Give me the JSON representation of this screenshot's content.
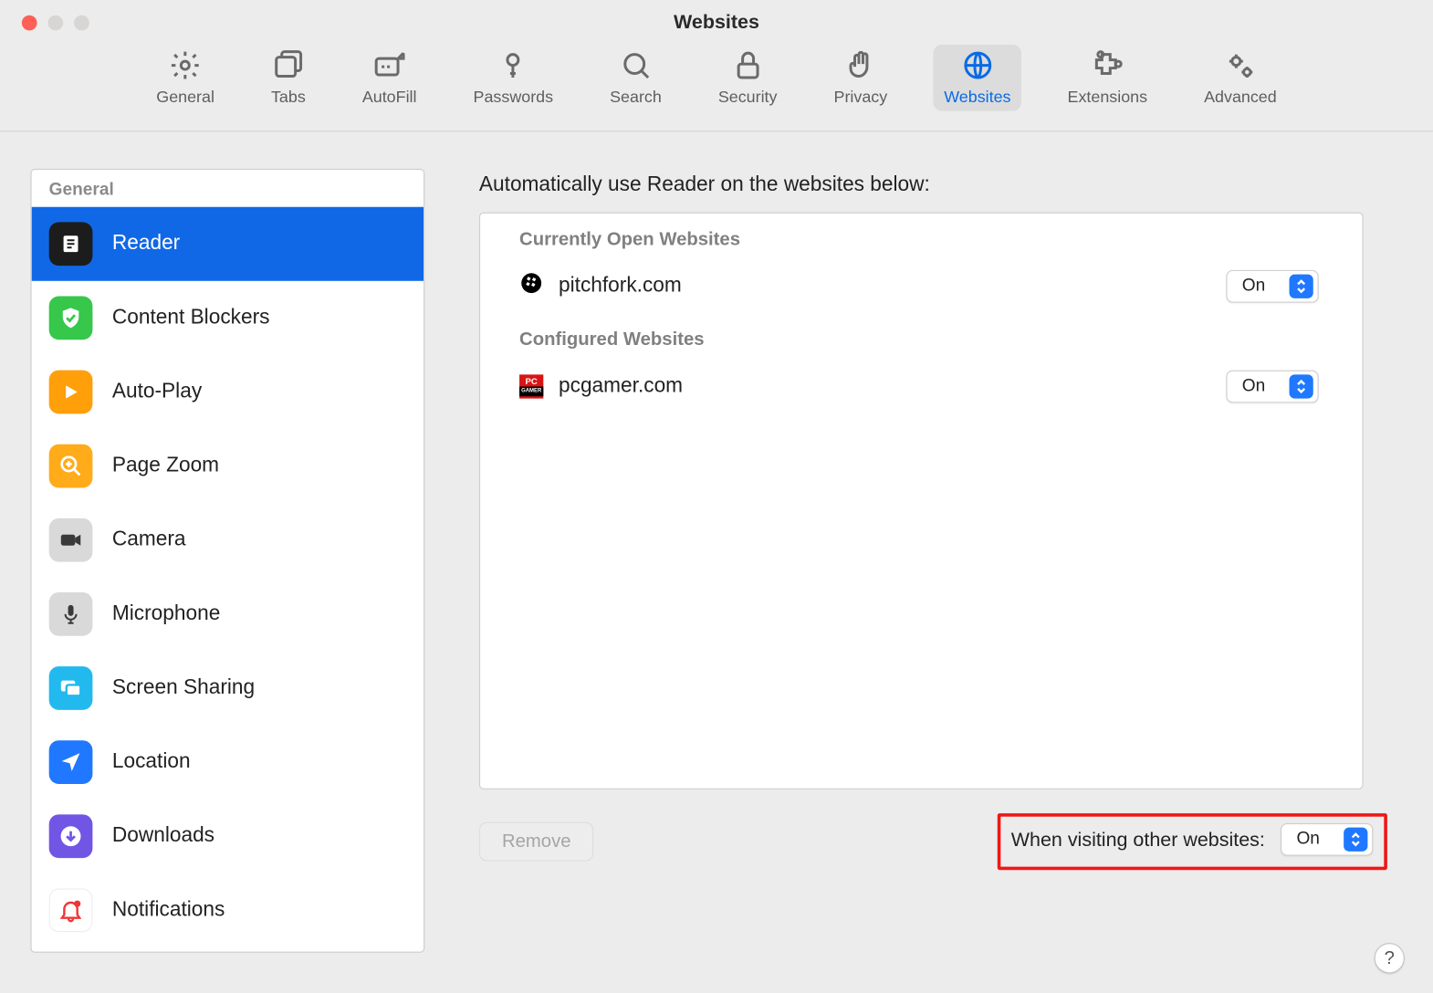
{
  "window": {
    "title": "Websites"
  },
  "toolbar": {
    "items": [
      {
        "label": "General"
      },
      {
        "label": "Tabs"
      },
      {
        "label": "AutoFill"
      },
      {
        "label": "Passwords"
      },
      {
        "label": "Search"
      },
      {
        "label": "Security"
      },
      {
        "label": "Privacy"
      },
      {
        "label": "Websites",
        "selected": true
      },
      {
        "label": "Extensions"
      },
      {
        "label": "Advanced"
      }
    ]
  },
  "sidebar": {
    "header": "General",
    "items": [
      {
        "label": "Reader",
        "selected": true
      },
      {
        "label": "Content Blockers"
      },
      {
        "label": "Auto-Play"
      },
      {
        "label": "Page Zoom"
      },
      {
        "label": "Camera"
      },
      {
        "label": "Microphone"
      },
      {
        "label": "Screen Sharing"
      },
      {
        "label": "Location"
      },
      {
        "label": "Downloads"
      },
      {
        "label": "Notifications"
      }
    ]
  },
  "main": {
    "heading": "Automatically use Reader on the websites below:",
    "group_open_header": "Currently Open Websites",
    "group_configured_header": "Configured Websites",
    "open_sites": [
      {
        "domain": "pitchfork.com",
        "value": "On"
      }
    ],
    "configured_sites": [
      {
        "domain": "pcgamer.com",
        "value": "On"
      }
    ],
    "remove_label": "Remove",
    "other_label": "When visiting other websites:",
    "other_value": "On"
  },
  "help": {
    "label": "?"
  }
}
